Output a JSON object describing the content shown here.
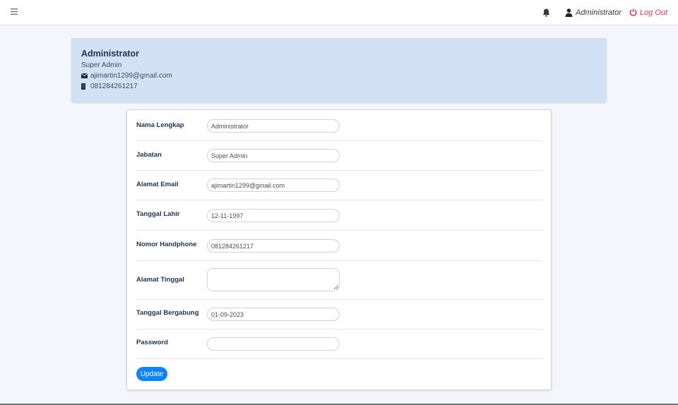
{
  "topbar": {
    "menu_icon": "hamburger-icon",
    "notification_icon": "bell-icon",
    "user_icon": "user-icon",
    "user_name": "Administrator",
    "logout_icon": "power-icon",
    "logout_label": "Log Out",
    "logout_color": "#dc3545"
  },
  "profile": {
    "name": "Administrator",
    "role": "Super Admin",
    "email_icon": "envelope-icon",
    "email": "ajimartin1299@gmail.com",
    "phone_icon": "mobile-icon",
    "phone": "081284261217",
    "card_color": "#d3e1f5"
  },
  "form": {
    "fields": [
      {
        "label": "Nama Lengkap",
        "value": "Administrator"
      },
      {
        "label": "Jabatan",
        "value": "Super Admin"
      },
      {
        "label": "Alamat Email",
        "value": "ajimartin1299@gmail.com"
      },
      {
        "label": "Tanggal Lahir",
        "value": "12-11-1997"
      },
      {
        "label": "Nomor Handphone",
        "value": "081284261217"
      },
      {
        "label": "Alamat Tinggal",
        "value": ""
      },
      {
        "label": "Tanggal Bergabung",
        "value": "01-09-2023"
      },
      {
        "label": "Password",
        "value": ""
      }
    ],
    "submit_label": "Update",
    "submit_color": "#0a84ff"
  }
}
